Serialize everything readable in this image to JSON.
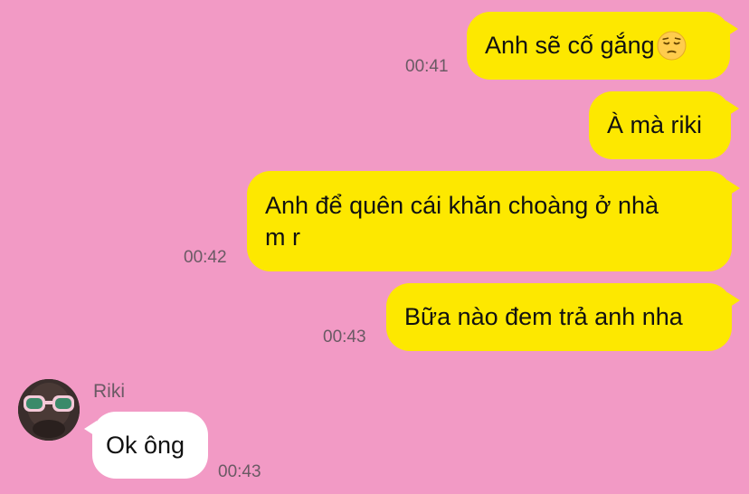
{
  "messages": [
    {
      "text": "Anh sẽ cố gắng",
      "emoji": "pensive-face-icon",
      "time": "00:41"
    },
    {
      "text": "À mà riki",
      "time": ""
    },
    {
      "text": "Anh để quên cái khăn choàng ở nhà\nm r",
      "time": "00:42"
    },
    {
      "text": "Bữa nào đem trả anh nha",
      "time": "00:43"
    }
  ],
  "incoming": {
    "sender": "Riki",
    "text": "Ok ông",
    "time": "00:43"
  },
  "colors": {
    "background": "#f29ac5",
    "outgoing_bubble": "#fde800",
    "incoming_bubble": "#ffffff"
  }
}
